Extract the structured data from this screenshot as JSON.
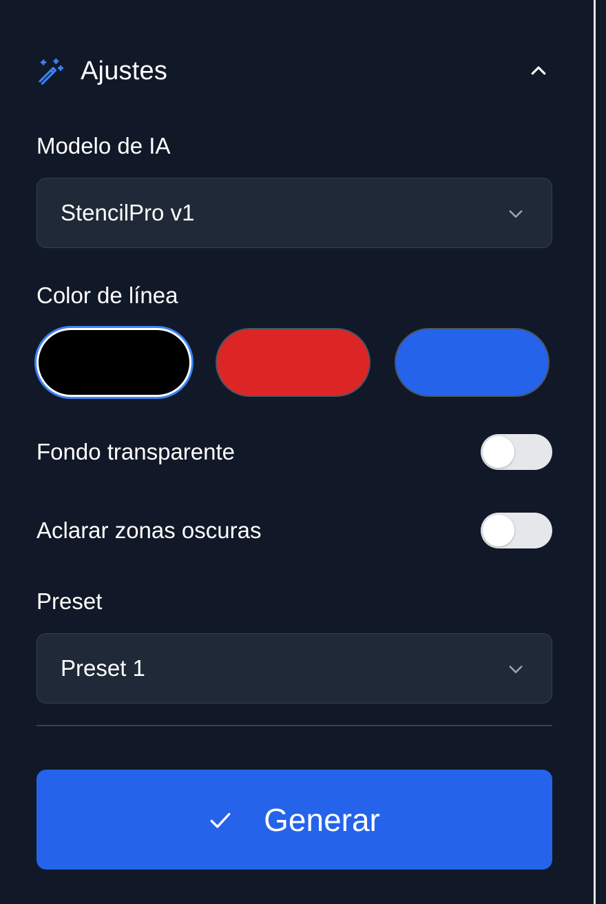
{
  "header": {
    "title": "Ajustes",
    "icon": "magic-wand-icon",
    "collapse_icon": "chevron-up-icon"
  },
  "model": {
    "label": "Modelo de IA",
    "selected": "StencilPro v1"
  },
  "line_color": {
    "label": "Color de línea",
    "swatches": [
      {
        "color": "#000000",
        "selected": true
      },
      {
        "color": "#dc2626",
        "selected": false
      },
      {
        "color": "#2563eb",
        "selected": false
      }
    ]
  },
  "toggles": {
    "transparent_bg": {
      "label": "Fondo transparente",
      "on": false
    },
    "lighten_dark": {
      "label": "Aclarar zonas oscuras",
      "on": false
    }
  },
  "preset": {
    "label": "Preset",
    "selected": "Preset 1"
  },
  "actions": {
    "generate_label": "Generar",
    "generate_icon": "check-icon"
  },
  "colors": {
    "background": "#111827",
    "field": "#1f2937",
    "accent": "#2563eb",
    "accent_icon": "#3b82f6"
  }
}
